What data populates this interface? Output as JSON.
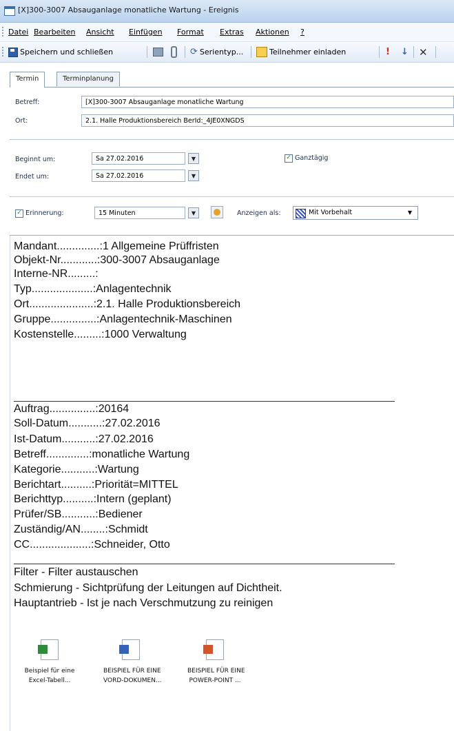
{
  "window": {
    "title": "[X]300-3007 Absauganlage monatliche Wartung - Ereignis"
  },
  "menu": [
    "Datei",
    "Bearbeiten",
    "Ansicht",
    "Einfügen",
    "Format",
    "Extras",
    "Aktionen",
    "?"
  ],
  "toolbar": {
    "save_close": "Speichern und schließen",
    "recurrence": "Serientyp...",
    "invite": "Teilnehmer einladen"
  },
  "tabs": [
    "Termin",
    "Terminplanung"
  ],
  "form": {
    "subject_label": "Betreff:",
    "subject_value": "[X]300-3007 Absauganlage monatliche Wartung",
    "location_label": "Ort:",
    "location_value": "2.1. Halle Produktionsbereich BerId:_4JE0XNGDS",
    "start_label": "Beginnt um:",
    "start_value": "Sa 27.02.2016",
    "end_label": "Endet um:",
    "end_value": "Sa 27.02.2016",
    "allday_label": "Ganztägig",
    "reminder_label": "Erinnerung:",
    "reminder_value": "15 Minuten",
    "showas_label": "Anzeigen als:",
    "showas_value": "Mit Vorbehalt"
  },
  "body": {
    "block1": [
      "Mandant..............:1 Allgemeine Prüffristen",
      "Objekt-Nr............:300-3007      Absauganlage",
      "Interne-NR.........:",
      "Typ....................:Anlagentechnik",
      "Ort.....................:2.1. Halle Produktionsbereich",
      "Gruppe...............:Anlagentechnik-Maschinen",
      "Kostenstelle.........:1000 Verwaltung"
    ],
    "block2": [
      "Auftrag...............:20164",
      "Soll-Datum...........:27.02.2016",
      "Ist-Datum...........:27.02.2016",
      "Betreff..............:monatliche Wartung",
      "Kategorie...........:Wartung",
      "Berichtart..........:Priorität=MITTEL",
      "Berichttyp..........:Intern (geplant)",
      "Prüfer/SB...........:Bediener",
      "Zuständig/AN........:Schmidt",
      "CC....................:Schneider, Otto"
    ],
    "block3": [
      "Filter        - Filter austauschen",
      "Schmierung     - Sichtprüfung der Leitungen auf Dichtheit.",
      "Hauptantrieb   - Ist je nach Verschmutzung zu reinigen"
    ]
  },
  "attachments": [
    {
      "icon": "excel-file-icon",
      "line1": "Beispiel für eine",
      "line2": "Excel-Tabell..."
    },
    {
      "icon": "word-file-icon",
      "line1": "BEISPIEL FÜR EINE",
      "line2": "VORD-DOKUMEN..."
    },
    {
      "icon": "powerpoint-file-icon",
      "line1": "BEISPIEL FÜR EINE",
      "line2": "POWER-POINT ..."
    }
  ]
}
